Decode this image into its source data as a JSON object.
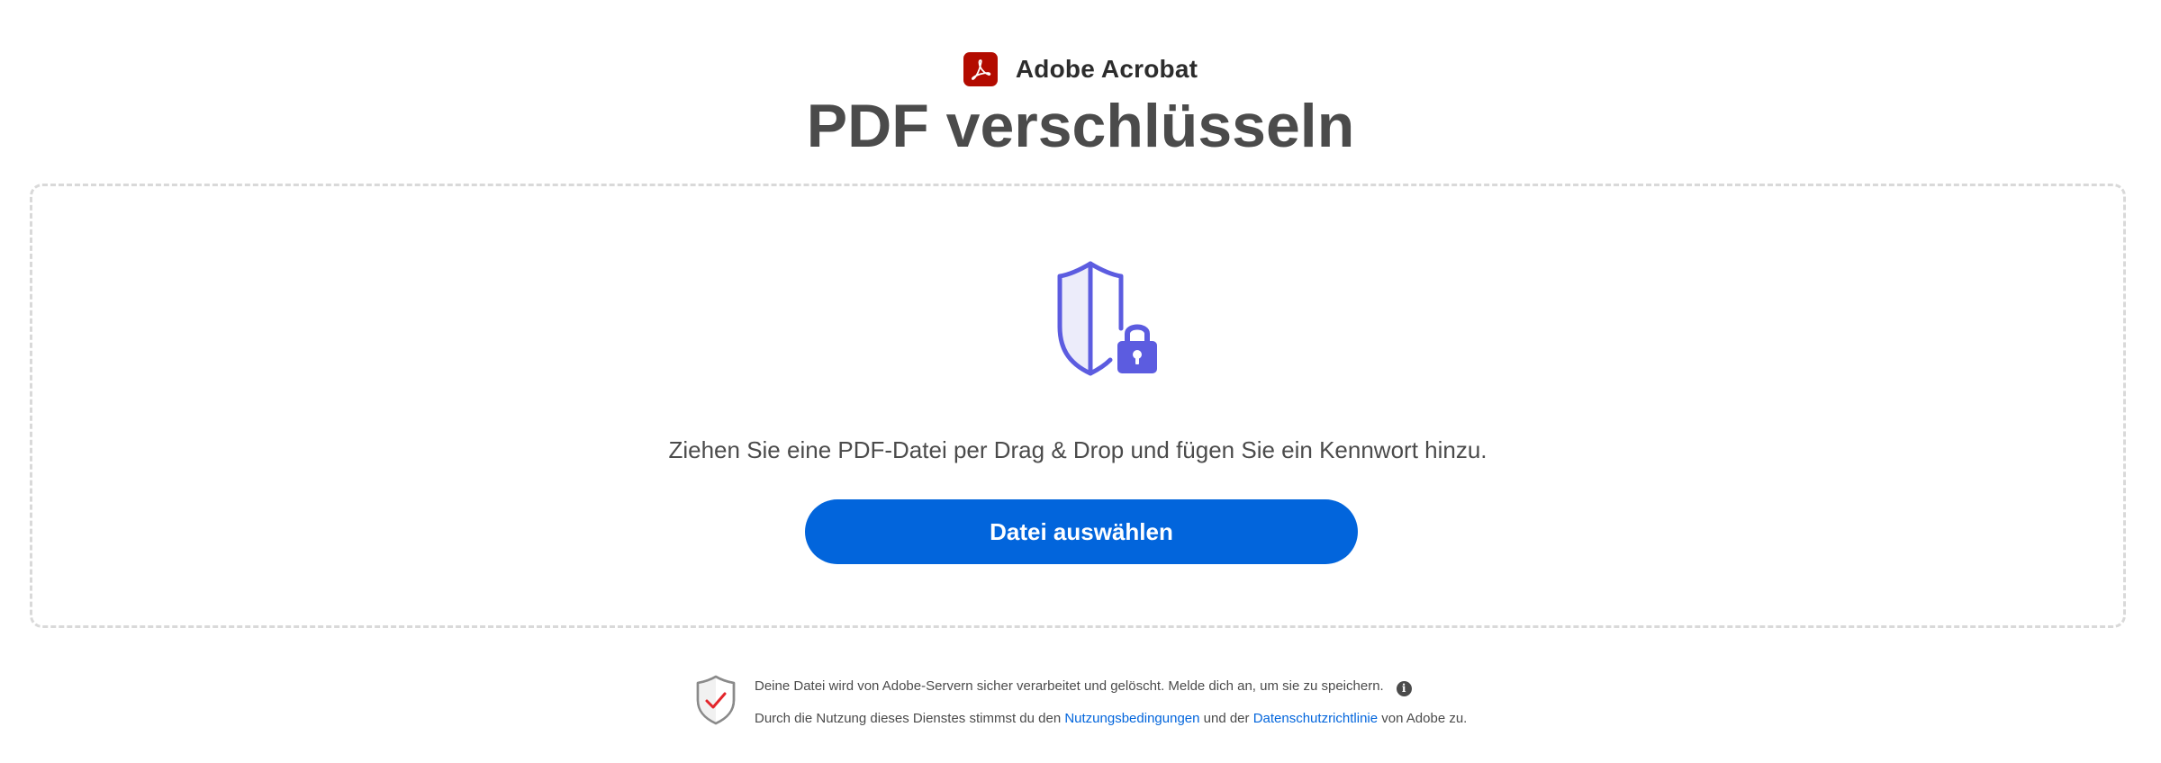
{
  "brand": {
    "name": "Adobe Acrobat",
    "logo_color": "#b30b00"
  },
  "page": {
    "title": "PDF verschlüsseln"
  },
  "dropzone": {
    "illustration": "shield-lock-icon",
    "instruction": "Ziehen Sie eine PDF-Datei per Drag & Drop und fügen Sie ein Kennwort hinzu.",
    "button_label": "Datei auswählen",
    "button_color": "#0265dc",
    "accent_color": "#5c5ce0"
  },
  "security_note": {
    "icon": "shield-check-icon",
    "line1": "Deine Datei wird von Adobe-Servern sicher verarbeitet und gelöscht. Melde dich an, um sie zu speichern.",
    "info_icon": "info-icon",
    "line2_prefix": "Durch die Nutzung dieses Dienstes stimmst du den",
    "terms_link": "Nutzungsbedingungen",
    "line2_middle": "und der",
    "privacy_link": "Datenschutzrichtlinie",
    "line2_suffix": "von Adobe zu."
  }
}
